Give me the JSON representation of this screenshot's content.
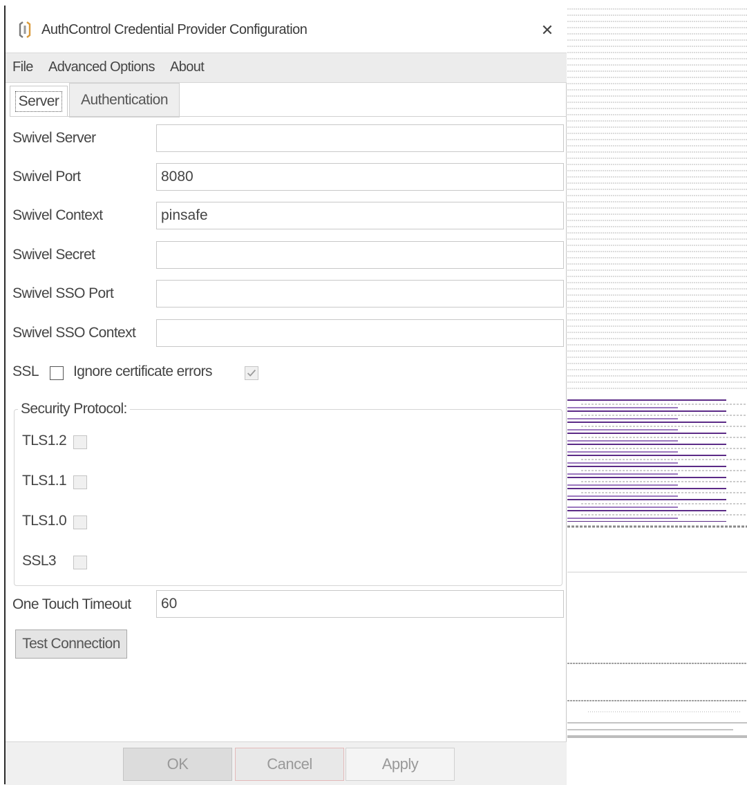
{
  "window": {
    "title": "AuthControl Credential Provider Configuration",
    "close_symbol": "✕"
  },
  "menu": {
    "items": [
      "File",
      "Advanced Options",
      "About"
    ]
  },
  "tabs": {
    "items": [
      "Server",
      "Authentication"
    ],
    "selected": "Server"
  },
  "server": {
    "fields": [
      {
        "label": "Swivel Server",
        "value": ""
      },
      {
        "label": "Swivel Port",
        "value": "8080"
      },
      {
        "label": "Swivel Context",
        "value": "pinsafe"
      },
      {
        "label": "Swivel Secret",
        "value": ""
      },
      {
        "label": "Swivel SSO Port",
        "value": ""
      },
      {
        "label": "Swivel SSO Context",
        "value": ""
      }
    ],
    "ssl_label": "SSL",
    "ssl_checked": false,
    "ignore_cert_label": "Ignore certificate errors",
    "ignore_cert_checked": true,
    "security_protocol": {
      "title": "Security Protocol:",
      "items": [
        {
          "label": "TLS1.2",
          "checked": false
        },
        {
          "label": "TLS1.1",
          "checked": false
        },
        {
          "label": "TLS1.0",
          "checked": false
        },
        {
          "label": "SSL3",
          "checked": false
        }
      ]
    },
    "one_touch_timeout_label": "One Touch Timeout",
    "one_touch_timeout_value": "60",
    "test_connection_label": "Test Connection"
  },
  "footer": {
    "ok_label": "OK",
    "cancel_label": "Cancel",
    "apply_label": "Apply"
  },
  "icons": {
    "app": "app-logo-icon",
    "close": "close-icon",
    "check": "checkmark-icon"
  },
  "colors": {
    "background": "#ffffff",
    "menubar": "#ececec",
    "text": "#444444",
    "border": "#c8c8c8",
    "side_panel_accent": "#5b2a86"
  }
}
